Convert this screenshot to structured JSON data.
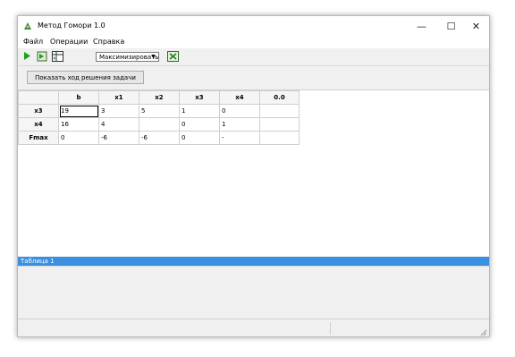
{
  "window": {
    "title": "Метод Гомори 1.0"
  },
  "titlebar_buttons": {
    "minimize": "—",
    "maximize": "☐",
    "close": "✕"
  },
  "menu": {
    "items": [
      "Файл",
      "Операции",
      "Справка"
    ]
  },
  "toolbar": {
    "select_value": "Максимизировать"
  },
  "panel": {
    "show_button": "Показать ход решения задачи"
  },
  "table": {
    "headers": [
      "",
      "b",
      "x1",
      "x2",
      "x3",
      "x4",
      "0.0"
    ],
    "rows": [
      {
        "label": "x3",
        "cells": [
          "19",
          "3",
          "5",
          "1",
          "0",
          ""
        ]
      },
      {
        "label": "x4",
        "cells": [
          "16",
          "4",
          "",
          "0",
          "1",
          ""
        ]
      },
      {
        "label": "Fmax",
        "cells": [
          "0",
          "-6",
          "-6",
          "0",
          "-",
          ""
        ]
      }
    ]
  },
  "log": {
    "selected_line": "Таблица 1"
  },
  "colors": {
    "accent": "#3a8fe0",
    "window_bg": "#f0f0f0"
  }
}
